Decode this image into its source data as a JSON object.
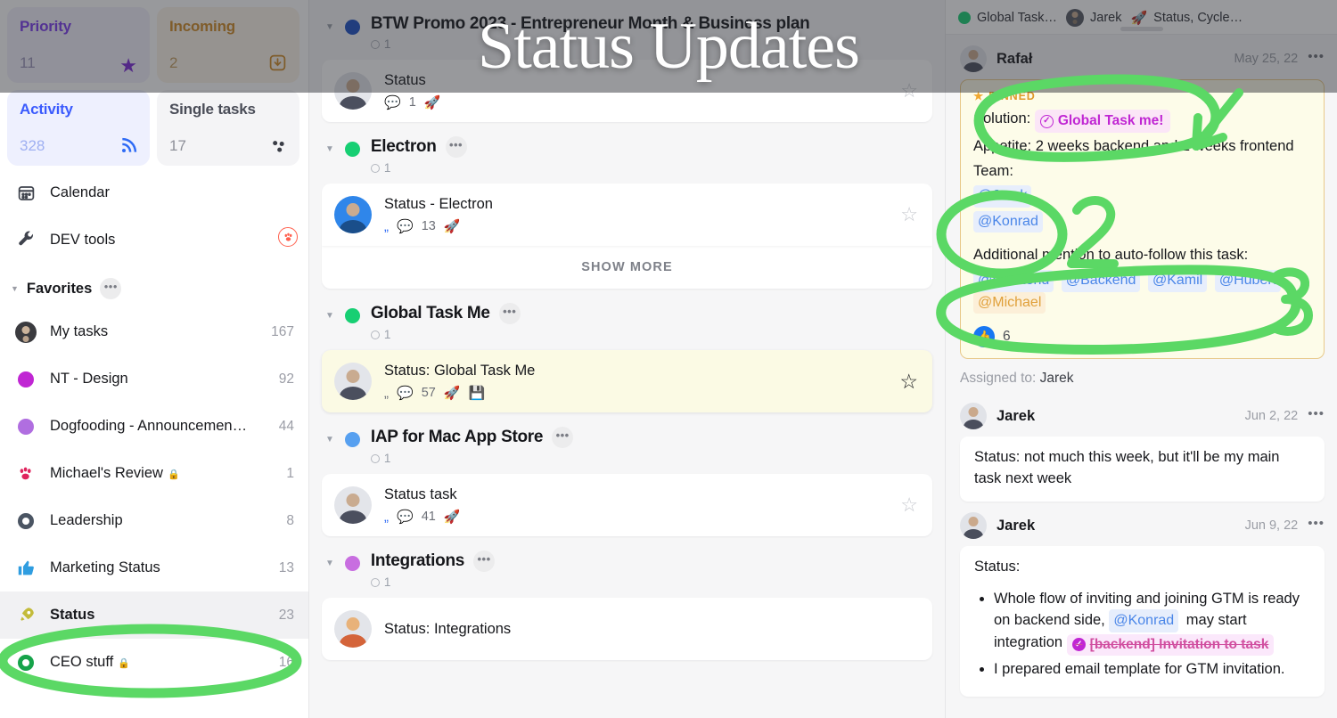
{
  "overlay": {
    "title": "Status Updates"
  },
  "sidebar": {
    "quick_cards": [
      {
        "title": "Priority",
        "count": "11",
        "icon": "star-icon",
        "glyph": "★"
      },
      {
        "title": "Incoming",
        "count": "2",
        "icon": "inbox-download-icon",
        "glyph": "⭳"
      },
      {
        "title": "Activity",
        "count": "328",
        "icon": "rss-icon",
        "glyph": "ᴿ"
      },
      {
        "title": "Single tasks",
        "count": "17",
        "icon": "dots-cluster-icon",
        "glyph": "⁘"
      }
    ],
    "nav": [
      {
        "label": "Calendar",
        "icon": "calendar-icon",
        "glyph": "📅",
        "count": ""
      },
      {
        "label": "DEV tools",
        "icon": "wrench-icon",
        "glyph": "🔧",
        "count": "",
        "badge": "🐾"
      }
    ],
    "favorites_header": {
      "label": "Favorites",
      "menu": "•••"
    },
    "favorites": [
      {
        "label": "My tasks",
        "count": "167",
        "icon": "avatar-photo",
        "marker": "avatar",
        "locked": false,
        "selected": false
      },
      {
        "label": "NT - Design",
        "count": "92",
        "icon": "dot-icon",
        "marker": "dot",
        "color": "#c026d3",
        "locked": false,
        "selected": false
      },
      {
        "label": "Dogfooding - Announcemen…",
        "count": "44",
        "icon": "dot-icon",
        "marker": "dot",
        "color": "#b06ee0",
        "locked": false,
        "selected": false
      },
      {
        "label": "Michael's Review",
        "count": "1",
        "icon": "paw-icon",
        "marker": "glyph",
        "glyph": "🐾",
        "locked": true,
        "selected": false
      },
      {
        "label": "Leadership",
        "count": "8",
        "icon": "ring-icon",
        "marker": "ring",
        "color": "#4b5563",
        "locked": false,
        "selected": false
      },
      {
        "label": "Marketing Status",
        "count": "13",
        "icon": "thumbs-up-icon",
        "marker": "glyph",
        "glyph": "👍",
        "locked": false,
        "selected": false
      },
      {
        "label": "Status",
        "count": "23",
        "icon": "rocket-icon",
        "marker": "glyph",
        "glyph": "🚀",
        "locked": false,
        "selected": true
      },
      {
        "label": "CEO stuff",
        "count": "16",
        "icon": "ring-icon",
        "marker": "ring",
        "color": "#16a34a",
        "locked": true,
        "selected": false
      }
    ]
  },
  "center": {
    "groups": [
      {
        "name": "BTW Promo 2023 - Entrepreneur Month & Business plan",
        "dot_color": "#1b50c4",
        "count": "1",
        "menu": "",
        "tasks": [
          {
            "title": "Status",
            "comments": "1",
            "has_rss": false,
            "has_rocket": true,
            "has_note": false,
            "starred": false,
            "avatar": "gray"
          }
        ],
        "show_more": false
      },
      {
        "name": "Electron",
        "dot_color": "#17cf73",
        "count": "1",
        "menu": "•••",
        "tasks": [
          {
            "title": "Status - Electron",
            "comments": "13",
            "has_rss": true,
            "has_rocket": true,
            "has_note": false,
            "starred": false,
            "avatar": "blue"
          }
        ],
        "show_more": true,
        "show_more_label": "SHOW MORE"
      },
      {
        "name": "Global Task Me",
        "dot_color": "#17cf73",
        "count": "1",
        "menu": "•••",
        "tasks": [
          {
            "title": "Status: Global Task Me",
            "comments": "57",
            "has_rss": true,
            "has_rocket": true,
            "has_note": true,
            "starred": true,
            "avatar": "gray",
            "selected": true
          }
        ],
        "show_more": false
      },
      {
        "name": "IAP for Mac App Store",
        "dot_color": "#57a0f0",
        "count": "1",
        "menu": "•••",
        "tasks": [
          {
            "title": "Status task",
            "comments": "41",
            "has_rss": true,
            "has_rocket": true,
            "has_note": false,
            "starred": false,
            "avatar": "gray"
          }
        ],
        "show_more": false
      },
      {
        "name": "Integrations",
        "dot_color": "#c86ee0",
        "count": "1",
        "menu": "•••",
        "tasks": [
          {
            "title": "Status: Integrations",
            "comments": "",
            "has_rss": false,
            "has_rocket": false,
            "has_note": false,
            "starred": false,
            "avatar": "orange"
          }
        ],
        "show_more": false
      }
    ]
  },
  "right_panel": {
    "tabs": [
      {
        "label": "Global Task…",
        "icon": "green-dot-icon"
      },
      {
        "label": "Jarek",
        "icon": "avatar-icon"
      },
      {
        "label": "Status, Cycle…",
        "icon": "rocket-icon",
        "glyph": "🚀"
      }
    ],
    "pinned_comment": {
      "author": "Rafał",
      "date": "May 25, 22",
      "menu": "•••",
      "pinned_label": "PINNED",
      "pinned_star": "★",
      "solution_prefix": "Solution:",
      "solution_tag": "Global Task me!",
      "appetite": "Appetite: 2 weeks backend and 2 weeks frontend",
      "team_label": "Team:",
      "team_mentions": [
        "@Jarek",
        "@Konrad"
      ],
      "followers_label": "Additional mention to auto-follow this task:",
      "follower_mentions": [
        "@Frontend",
        "@Backend",
        "@Kamil",
        "@Hubert"
      ],
      "follower_mention_amber": "@Michael",
      "reaction_icon": "thumbs-up-icon",
      "reaction_count": "6"
    },
    "assigned_prefix": "Assigned to:",
    "assigned_to": "Jarek",
    "comments": [
      {
        "author": "Jarek",
        "date": "Jun 2, 22",
        "menu": "•••",
        "text": "Status: not much this week, but it'll be my main task next week"
      },
      {
        "author": "Jarek",
        "date": "Jun 9, 22",
        "menu": "•••",
        "text": "Status:",
        "bullets": [
          {
            "pre": "Whole flow of inviting and joining GTM is ready on backend side,",
            "mention": "@Konrad",
            "mid": "may start integration",
            "strike_tag": "[backend] Invitation to task"
          },
          {
            "pre": "I prepared email template for GTM invitation."
          }
        ]
      }
    ]
  },
  "annotations": {
    "color": "#5bd865",
    "marks": [
      {
        "name": "circle-status-sidebar",
        "label": ""
      },
      {
        "name": "circle-solution-tag",
        "label": "1"
      },
      {
        "name": "circle-team-mentions",
        "label": "2"
      },
      {
        "name": "circle-follower-mentions",
        "label": "3"
      }
    ]
  }
}
